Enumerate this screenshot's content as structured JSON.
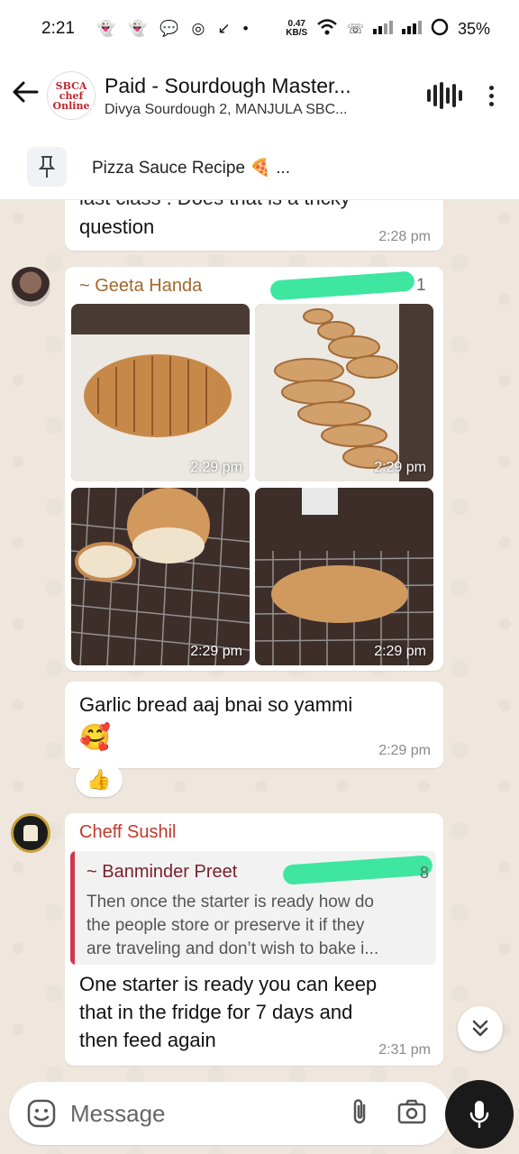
{
  "status_bar": {
    "time": "2:21",
    "net_speed_value": "0.47",
    "net_speed_unit": "KB/S",
    "battery": "35%"
  },
  "header": {
    "title": "Paid - Sourdough Master...",
    "subtitle": "Divya Sourdough 2, MANJULA SBC...",
    "avatar_text": "SBCA chef Online"
  },
  "pinned": {
    "text": "Pizza Sauce Recipe 🍕 ..."
  },
  "messages": {
    "m1": {
      "partial_line": "last class . Does that is a tricky",
      "text": "question",
      "time": "2:28 pm"
    },
    "m2": {
      "sender": "~ Geeta Handa",
      "phone_tail": "1",
      "photos": [
        {
          "time": "2:29 pm"
        },
        {
          "time": "2:29 pm"
        },
        {
          "time": "2:29 pm"
        },
        {
          "time": "2:29 pm"
        }
      ]
    },
    "m3": {
      "line1": "Garlic bread aaj bnai so yammi",
      "emoji": "🥰",
      "time": "2:29 pm",
      "reaction": "👍"
    },
    "m4": {
      "sender": "Cheff Sushil",
      "quote_sender": "~ Banminder Preet",
      "quote_phone_tail": "8",
      "quote_lines": [
        "Then once the starter is ready how do",
        "the people store or preserve it if they",
        "are traveling and don’t wish to bake i..."
      ],
      "lines": [
        "One starter is ready you can keep",
        "that in the fridge for 7 days and",
        "then feed again"
      ],
      "time": "2:31 pm"
    }
  },
  "composer": {
    "placeholder": "Message"
  },
  "colors": {
    "sender_geeta": "#a1682a",
    "sender_sushil": "#c0392b",
    "quote_sender": "#7a1f2b",
    "quote_bar": "#d4364f",
    "redaction": "#3ee6a0"
  }
}
